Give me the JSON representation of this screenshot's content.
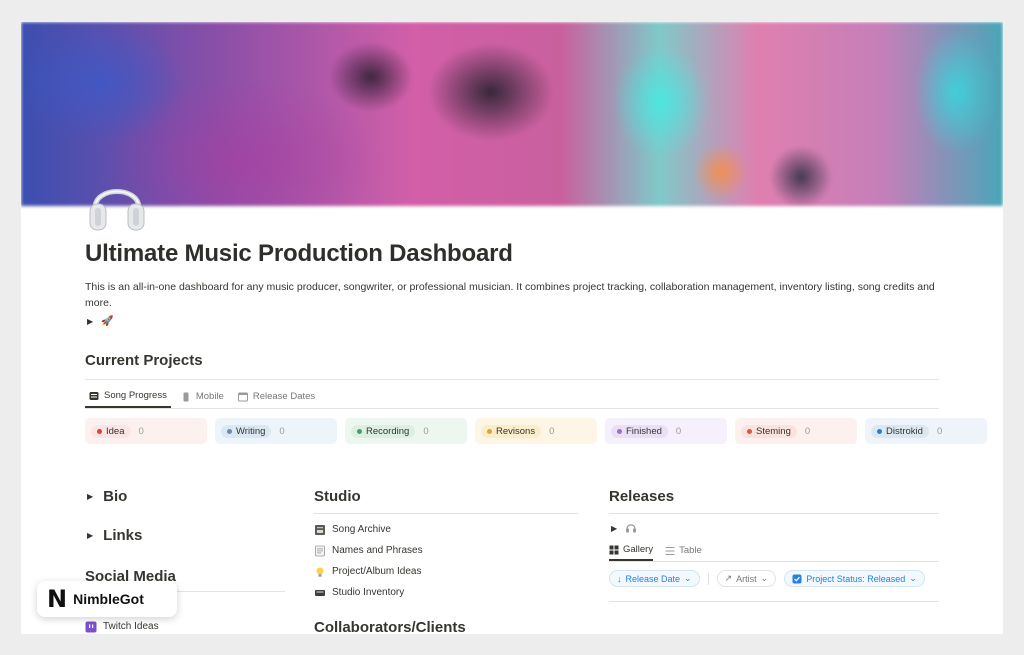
{
  "page": {
    "title": "Ultimate Music Production Dashboard",
    "description": "This is an all-in-one dashboard for any music producer, songwriter, or professional musician. It combines project tracking, collaboration management, inventory listing, song credits and more.",
    "icon": "headphones-icon",
    "toggle_emoji": "🚀"
  },
  "current_projects": {
    "title": "Current Projects",
    "tabs": [
      {
        "label": "Song Progress",
        "icon": "board-icon",
        "active": true
      },
      {
        "label": "Mobile",
        "icon": "phone-icon",
        "active": false
      },
      {
        "label": "Release Dates",
        "icon": "calendar-icon",
        "active": false
      }
    ],
    "columns": [
      {
        "label": "Idea",
        "count": "0",
        "color": "#e03e3e",
        "bg": "#fdf1ef",
        "pill": "#fbe4e4"
      },
      {
        "label": "Writing",
        "count": "0",
        "color": "#6b8ab0",
        "bg": "#eef5fa",
        "pill": "#dbe8f3"
      },
      {
        "label": "Recording",
        "count": "0",
        "color": "#4d9a6a",
        "bg": "#eef6f0",
        "pill": "#dcefe2"
      },
      {
        "label": "Revisons",
        "count": "0",
        "color": "#d9a53a",
        "bg": "#fdf6e7",
        "pill": "#fbeccb"
      },
      {
        "label": "Finished",
        "count": "0",
        "color": "#9a6dd7",
        "bg": "#f5f0fb",
        "pill": "#e9e0f6"
      },
      {
        "label": "Steming",
        "count": "0",
        "color": "#e0553e",
        "bg": "#fdf1ef",
        "pill": "#fbe2de"
      },
      {
        "label": "Distrokid",
        "count": "0",
        "color": "#2a7fc9",
        "bg": "#eef4fa",
        "pill": "#dbe8f3"
      }
    ]
  },
  "bio": {
    "label": "Bio"
  },
  "links": {
    "label": "Links"
  },
  "social_media": {
    "title": "Social Media",
    "items": [
      {
        "label": "Twitch Ideas",
        "icon": "twitch-icon"
      }
    ]
  },
  "studio": {
    "title": "Studio",
    "items": [
      {
        "label": "Song Archive",
        "icon": "archive-icon"
      },
      {
        "label": "Names and Phrases",
        "icon": "notepad-icon"
      },
      {
        "label": "Project/Album Ideas",
        "icon": "lightbulb-icon"
      },
      {
        "label": "Studio Inventory",
        "icon": "tray-icon"
      }
    ],
    "next_title": "Collaborators/Clients"
  },
  "releases": {
    "title": "Releases",
    "toggle_icon": "headphones-icon",
    "tabs": [
      {
        "label": "Gallery",
        "icon": "gallery-icon",
        "active": true
      },
      {
        "label": "Table",
        "icon": "table-icon",
        "active": false
      }
    ],
    "filters": [
      {
        "label": "Release Date",
        "style": "blue",
        "icon": "arrow-down-icon"
      },
      {
        "label": "Artist",
        "style": "gray",
        "icon": "arrow-icon"
      },
      {
        "label": "Project Status: Released",
        "style": "blue",
        "icon": "status-icon"
      }
    ]
  },
  "watermark": {
    "logo": "N",
    "text": "NimbleGot"
  }
}
